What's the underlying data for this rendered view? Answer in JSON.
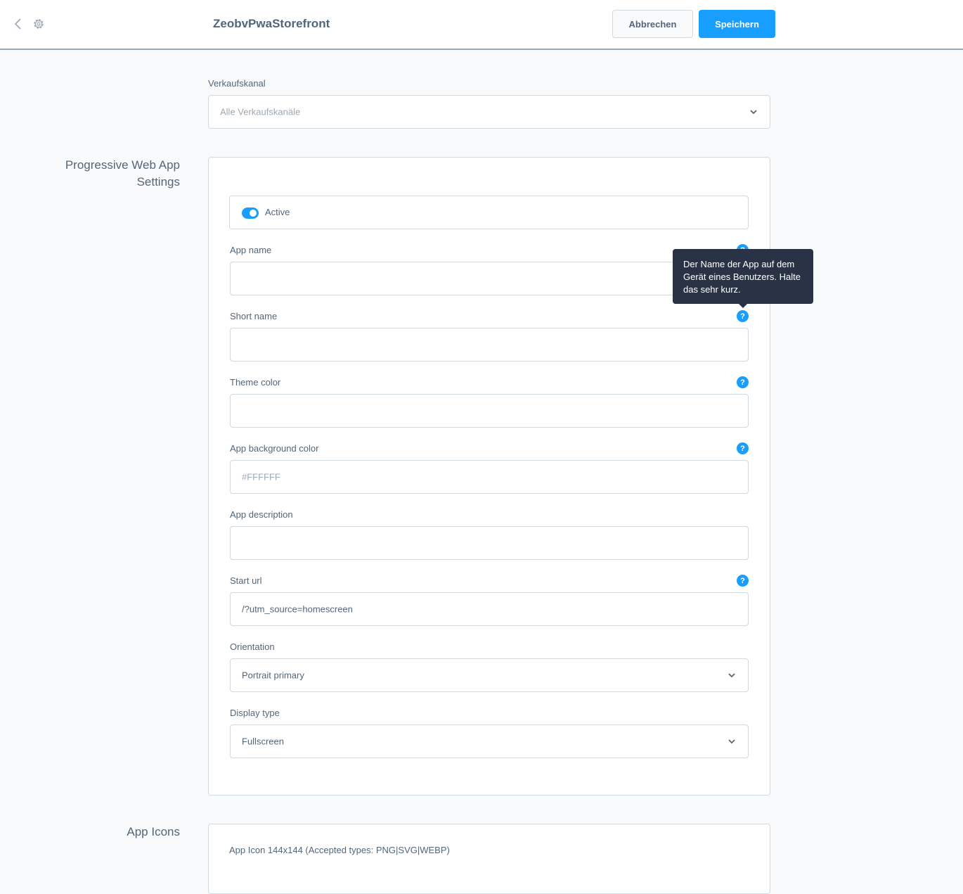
{
  "header": {
    "title": "ZeobvPwaStorefront",
    "cancel_label": "Abbrechen",
    "save_label": "Speichern"
  },
  "sales_channel": {
    "label": "Verkaufskanal",
    "placeholder": "Alle Verkaufskanäle"
  },
  "pwa_section": {
    "title_line1": "Progressive Web App",
    "title_line2": "Settings",
    "active_toggle": {
      "label": "Active",
      "checked": true
    },
    "fields": {
      "app_name": {
        "label": "App name",
        "value": ""
      },
      "short_name": {
        "label": "Short name",
        "value": ""
      },
      "theme_color": {
        "label": "Theme color",
        "value": ""
      },
      "app_background_color": {
        "label": "App background color",
        "value": "",
        "placeholder": "#FFFFFF"
      },
      "app_description": {
        "label": "App description",
        "value": ""
      },
      "start_url": {
        "label": "Start url",
        "value": "/?utm_source=homescreen"
      },
      "orientation": {
        "label": "Orientation",
        "value": "Portrait primary"
      },
      "display_type": {
        "label": "Display type",
        "value": "Fullscreen"
      }
    },
    "help_glyph": "?",
    "tooltip": "Der Name der App auf dem Gerät eines Benutzers. Halte das sehr kurz."
  },
  "icons_section": {
    "title": "App Icons",
    "first_item_label": "App Icon 144x144 (Accepted types: PNG|SVG|WEBP)"
  },
  "colors": {
    "accent": "#189eff",
    "text": "#52667a",
    "border": "#d1d9e0",
    "tooltip_bg": "#2a3345"
  }
}
